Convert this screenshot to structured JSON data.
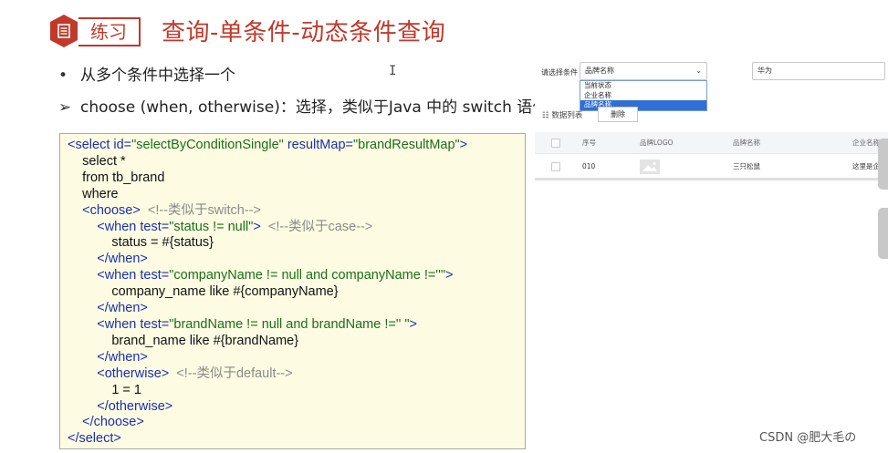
{
  "header": {
    "tag": "练习",
    "title": "查询-单条件-动态条件查询"
  },
  "bullets": [
    {
      "mark": "•",
      "text": "从多个条件中选择一个"
    },
    {
      "mark": "➢",
      "text": "choose (when, otherwise)：选择，类似于Java 中的 switch 语句"
    }
  ],
  "code": {
    "line1": {
      "p1": "<select ",
      "a1": "id=",
      "v1": "\"selectByConditionSingle\"",
      "a2": " resultMap=",
      "v2": "\"brandResultMap\"",
      "p2": ">"
    },
    "line2": "    select *",
    "line3": "    from tb_brand",
    "line4": "    where",
    "line5": {
      "tag": "    <choose>",
      "comment": "  <!--类似于switch-->"
    },
    "line6": {
      "tag": "        <when ",
      "attr": "test=",
      "val": "\"status != null\"",
      "end": ">",
      "comment": "  <!--类似于case-->"
    },
    "line7": "            status = #{status}",
    "line8": "        </when>",
    "line9": {
      "tag": "        <when ",
      "attr": "test=",
      "val": "\"companyName != null and companyName !=''\"",
      "end": ">"
    },
    "line10": "            company_name like #{companyName}",
    "line11": "        </when>",
    "line12": {
      "tag": "        <when ",
      "attr": "test=",
      "val": "\"brandName != null and brandName !='' \"",
      "end": ">"
    },
    "line13": "            brand_name like #{brandName}",
    "line14": "        </when>",
    "line15": {
      "tag": "        <otherwise>",
      "comment": "  <!--类似于default-->"
    },
    "line16": "            1 = 1",
    "line17": "        </otherwise>",
    "line18": "    </choose>",
    "line19": "</select>"
  },
  "ui": {
    "filter_label": "请选择条件",
    "select_value": "品牌名称",
    "dropdown_options": [
      "当前状态",
      "企业名称",
      "品牌名称"
    ],
    "dropdown_selected_index": 2,
    "search_value": "华为",
    "list_title": "☷ 数据列表",
    "delete_label": "删除",
    "columns": [
      "序号",
      "品牌LOGO",
      "品牌名称",
      "企业名称"
    ],
    "row": {
      "seq": "010",
      "brand": "三只松鼠",
      "company": "这里是企业"
    }
  },
  "watermark": "CSDN @肥大毛の",
  "colors": {
    "accent": "#c0392b",
    "code_bg": "#fdfce3",
    "dropdown_selected": "#2f6fd6"
  }
}
